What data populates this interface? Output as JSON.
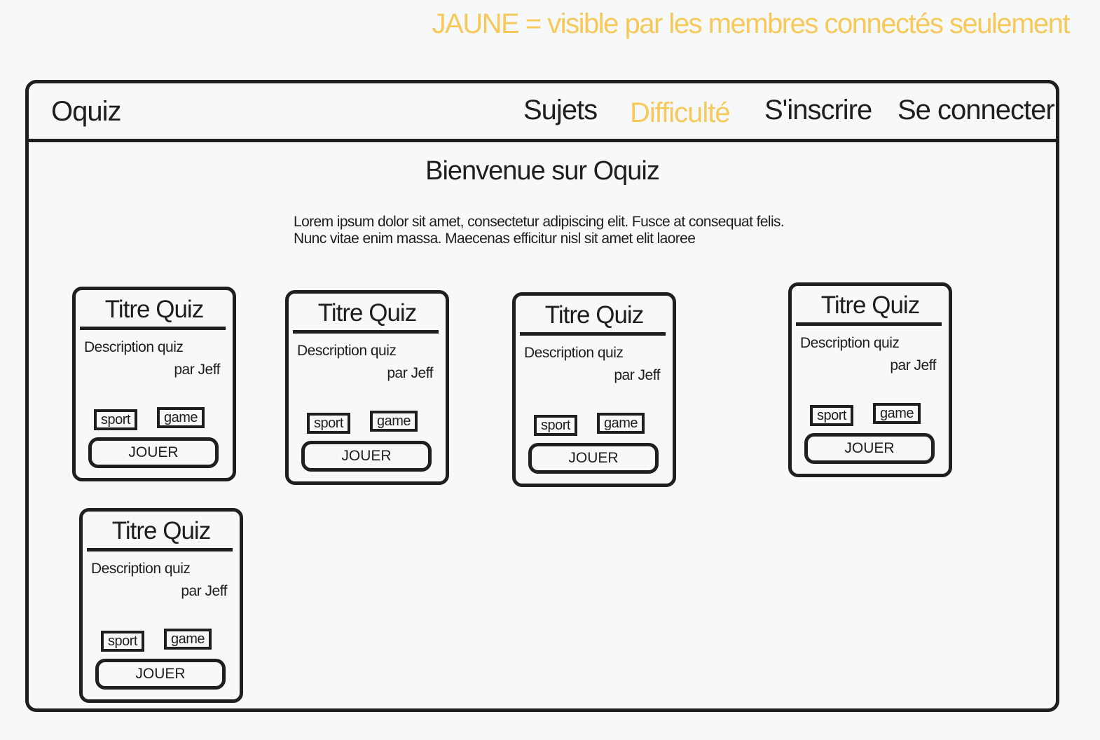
{
  "legend": "JAUNE = visible par les membres connectés seulement",
  "header": {
    "brand": "Oquiz",
    "nav": [
      {
        "label": "Sujets",
        "members_only": false
      },
      {
        "label": "Difficulté",
        "members_only": true
      },
      {
        "label": "S'inscrire",
        "members_only": false
      },
      {
        "label": "Se connecter",
        "members_only": false
      }
    ]
  },
  "main": {
    "title": "Bienvenue sur Oquiz",
    "intro": [
      "Lorem ipsum dolor sit amet, consectetur adipiscing elit. Fusce at consequat felis.",
      "Nunc vitae enim massa. Maecenas efficitur nisl sit amet elit laoree"
    ],
    "quizzes": [
      {
        "title": "Titre Quiz",
        "description": "Description quiz",
        "author": "par Jeff",
        "tags": [
          "sport",
          "game"
        ],
        "play": "JOUER"
      },
      {
        "title": "Titre Quiz",
        "description": "Description quiz",
        "author": "par Jeff",
        "tags": [
          "sport",
          "game"
        ],
        "play": "JOUER"
      },
      {
        "title": "Titre Quiz",
        "description": "Description quiz",
        "author": "par Jeff",
        "tags": [
          "sport",
          "game"
        ],
        "play": "JOUER"
      },
      {
        "title": "Titre Quiz",
        "description": "Description quiz",
        "author": "par Jeff",
        "tags": [
          "sport",
          "game"
        ],
        "play": "JOUER"
      },
      {
        "title": "Titre Quiz",
        "description": "Description quiz",
        "author": "par Jeff",
        "tags": [
          "sport",
          "game"
        ],
        "play": "JOUER"
      }
    ]
  },
  "colors": {
    "members_only": "#f6c95a",
    "ink": "#1f1f1f",
    "background": "#f7f8fa"
  }
}
